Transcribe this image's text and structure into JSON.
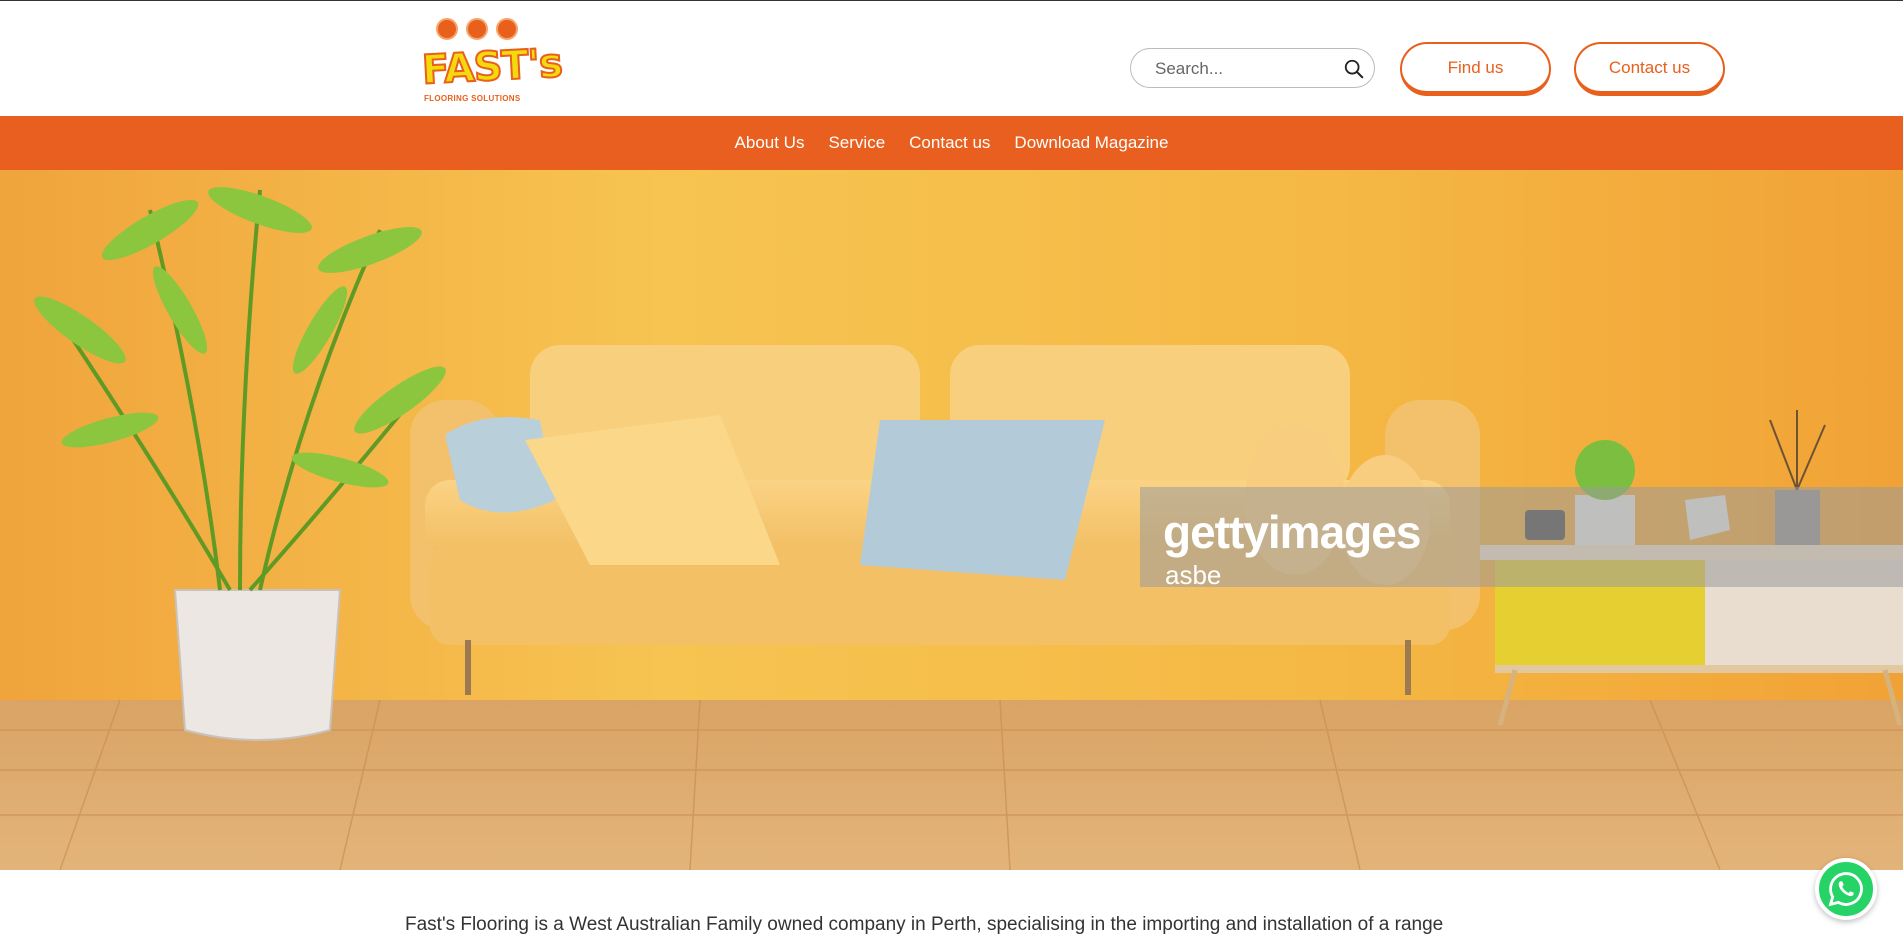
{
  "brand": {
    "name": "FAST's",
    "tagline": "FLOORING SOLUTIONS",
    "accent_color": "#e85f1f",
    "logo_yellow": "#f5d90f"
  },
  "header": {
    "search": {
      "placeholder": "Search...",
      "value": ""
    },
    "buttons": {
      "find_us": "Find us",
      "contact_us": "Contact us"
    }
  },
  "nav": {
    "items": [
      {
        "label": "About Us"
      },
      {
        "label": "Service"
      },
      {
        "label": "Contact us"
      },
      {
        "label": "Download Magazine"
      }
    ]
  },
  "hero": {
    "watermark_brand": "gettyimages",
    "watermark_credit": "asbe"
  },
  "intro": {
    "text": "Fast's Flooring is a West Australian Family owned company in Perth, specialising in the importing and installation of a range"
  },
  "icons": {
    "search": "search-icon",
    "whatsapp": "whatsapp-icon"
  }
}
